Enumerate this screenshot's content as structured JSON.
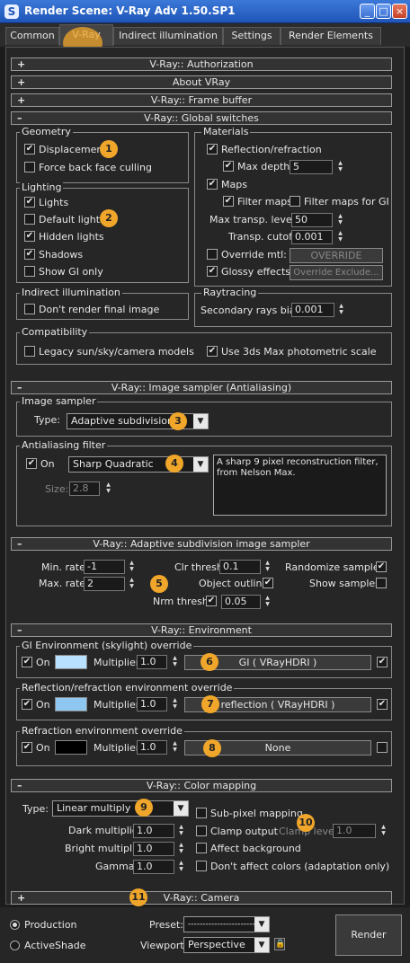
{
  "window": {
    "title": "Render Scene: V-Ray Adv 1.50.SP1",
    "min": "_",
    "max": "□",
    "close": "×"
  },
  "tabs": [
    "Common",
    "V-Ray",
    "Indirect illumination",
    "Settings",
    "Render Elements"
  ],
  "rollouts": {
    "authorization": "V-Ray:: Authorization",
    "about": "About VRay",
    "frame_buffer": "V-Ray:: Frame buffer",
    "global_switches": "V-Ray:: Global switches",
    "image_sampler": "V-Ray:: Image sampler (Antialiasing)",
    "adaptive": "V-Ray:: Adaptive subdivision image sampler",
    "environment": "V-Ray:: Environment",
    "color_mapping": "V-Ray:: Color mapping",
    "camera": "V-Ray:: Camera"
  },
  "rollout_signs": {
    "plus": "+",
    "minus": "–"
  },
  "global": {
    "geometry": {
      "title": "Geometry",
      "displacement": "Displacement",
      "force_back": "Force back face culling"
    },
    "lighting": {
      "title": "Lighting",
      "lights": "Lights",
      "default_lights": "Default lights",
      "hidden_lights": "Hidden lights",
      "shadows": "Shadows",
      "show_gi": "Show GI only"
    },
    "indirect": {
      "title": "Indirect illumination",
      "dont_render": "Don't render final image"
    },
    "materials": {
      "title": "Materials",
      "reflection": "Reflection/refraction",
      "max_depth": "Max depth",
      "max_depth_val": "5",
      "maps": "Maps",
      "filter_maps": "Filter maps",
      "filter_maps_gi": "Filter maps for GI",
      "max_transp": "Max transp. levels",
      "max_transp_val": "50",
      "transp_cutoff": "Transp. cutoff",
      "transp_cutoff_val": "0.001",
      "override_mtl": "Override mtl:",
      "override_btn": "OVERRIDE",
      "glossy": "Glossy effects",
      "override_exclude": "Override Exclude..."
    },
    "raytracing": {
      "title": "Raytracing",
      "bias": "Secondary rays bias",
      "bias_val": "0.001"
    },
    "compat": {
      "title": "Compatibility",
      "legacy": "Legacy sun/sky/camera models",
      "use_3ds": "Use 3ds Max photometric scale"
    }
  },
  "image_sampler": {
    "title": "Image sampler",
    "type_label": "Type:",
    "type_value": "Adaptive subdivision",
    "aa_title": "Antialiasing filter",
    "on": "On",
    "filter": "Sharp Quadratic",
    "desc": "A sharp 9 pixel reconstruction filter, from Nelson Max.",
    "size_label": "Size:",
    "size_val": "2.8"
  },
  "adaptive": {
    "min_rate": "Min. rate:",
    "min_rate_val": "-1",
    "max_rate": "Max. rate:",
    "max_rate_val": "2",
    "clr_thresh": "Clr thresh:",
    "clr_thresh_val": "0.1",
    "obj_outline": "Object outline",
    "nrm_thresh": "Nrm thresh:",
    "nrm_thresh_val": "0.05",
    "randomize": "Randomize samples",
    "show_samples": "Show samples"
  },
  "environment": {
    "gi": {
      "title": "GI Environment (skylight) override",
      "on": "On",
      "mult": "Multiplier:",
      "mult_val": "1.0",
      "map": "GI  ( VRayHDRI )"
    },
    "refl": {
      "title": "Reflection/refraction environment override",
      "on": "On",
      "mult": "Multiplier:",
      "mult_val": "1.0",
      "map": "reflection  ( VRayHDRI )"
    },
    "refr": {
      "title": "Refraction environment override",
      "on": "On",
      "mult": "Multiplier:",
      "mult_val": "1.0",
      "map": "None"
    }
  },
  "color_mapping": {
    "type_label": "Type:",
    "type_value": "Linear multiply",
    "dark": "Dark multiplier:",
    "dark_val": "1.0",
    "bright": "Bright multiplier:",
    "bright_val": "1.0",
    "gamma": "Gamma:",
    "gamma_val": "1.0",
    "subpixel": "Sub-pixel mapping",
    "clamp": "Clamp output",
    "clamp_level": "Clamp level:",
    "clamp_level_val": "1.0",
    "affect_bg": "Affect background",
    "dont_affect": "Don't affect colors (adaptation only)"
  },
  "bottom": {
    "production": "Production",
    "activeshade": "ActiveShade",
    "preset": "Preset:",
    "preset_val": "--------------------------",
    "viewport": "Viewport:",
    "viewport_val": "Perspective",
    "render": "Render"
  },
  "markers": [
    "1",
    "2",
    "3",
    "4",
    "5",
    "6",
    "7",
    "8",
    "9",
    "10",
    "11"
  ],
  "colors": {
    "accent_marker": "#f0a62a",
    "title_bar": "#1f55b8",
    "gi_swatch": "#b8e0ff",
    "refl_swatch": "#8ec8f0",
    "refr_swatch": "#000000"
  }
}
